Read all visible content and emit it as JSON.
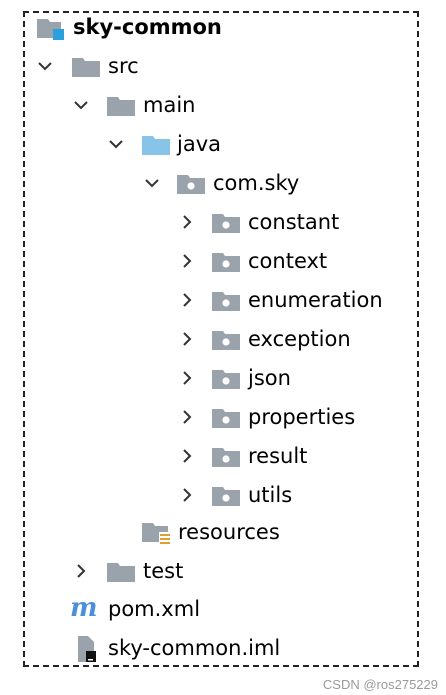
{
  "tree": {
    "root": {
      "label": "sky-common"
    },
    "src": {
      "label": "src"
    },
    "main": {
      "label": "main"
    },
    "java": {
      "label": "java"
    },
    "package": {
      "label": "com.sky"
    },
    "subpackages": [
      {
        "label": "constant"
      },
      {
        "label": "context"
      },
      {
        "label": "enumeration"
      },
      {
        "label": "exception"
      },
      {
        "label": "json"
      },
      {
        "label": "properties"
      },
      {
        "label": "result"
      },
      {
        "label": "utils"
      }
    ],
    "resources": {
      "label": "resources"
    },
    "test": {
      "label": "test"
    },
    "pom": {
      "label": "pom.xml",
      "icon_glyph": "m"
    },
    "iml": {
      "label": "sky-common.iml"
    }
  },
  "watermark": "CSDN @ros275229",
  "colors": {
    "folder": "#9aa3ab",
    "source_folder": "#87c4e8",
    "module_badge": "#2aa1dd",
    "pom_icon": "#4a90d9",
    "resources_badge": "#e0a030"
  }
}
